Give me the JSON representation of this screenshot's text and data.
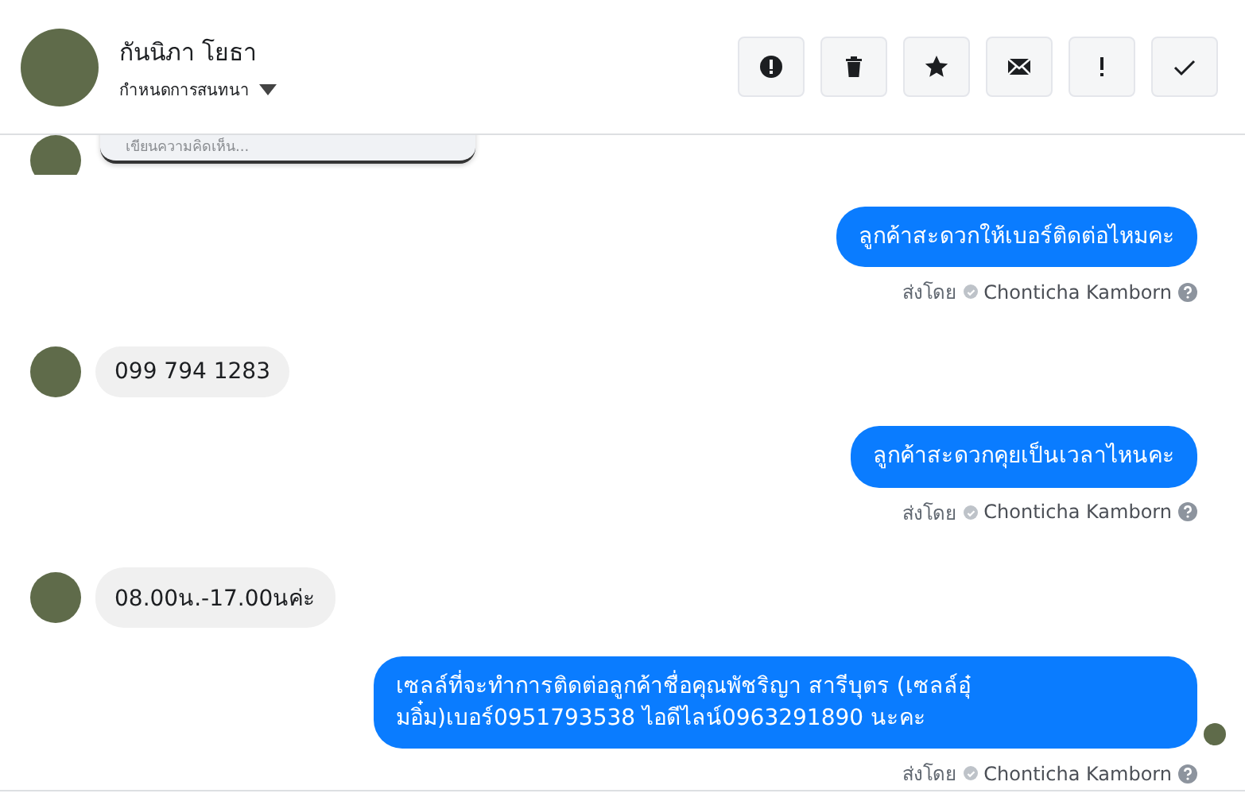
{
  "header": {
    "name": "กันนิภา โยธา",
    "subtitle": "กำหนดการสนทนา"
  },
  "actions": [
    {
      "kind": "alert"
    },
    {
      "kind": "trash"
    },
    {
      "kind": "star"
    },
    {
      "kind": "mail"
    },
    {
      "kind": "important"
    },
    {
      "kind": "done"
    }
  ],
  "comment_box": {
    "placeholder": "เขียนความคิดเห็น..."
  },
  "messages": [
    {
      "kind": "outgoing",
      "text": "ลูกค้าสะดวกให้เบอร์ติดต่อไหมคะ",
      "sent_by_label": "ส่งโดย",
      "sender": "Chonticha Kamborn",
      "seen": false
    },
    {
      "kind": "incoming",
      "text": "099 794 1283"
    },
    {
      "kind": "outgoing",
      "text": "ลูกค้าสะดวกคุยเป็นเวลาไหนคะ",
      "sent_by_label": "ส่งโดย",
      "sender": "Chonticha Kamborn",
      "seen": false
    },
    {
      "kind": "incoming",
      "text": "08.00น.-17.00นค่ะ"
    },
    {
      "kind": "outgoing",
      "text": "เซลล์ที่จะทำการติดต่อลูกค้าชื่อคุณพัชริญา สารีบุตร (เซลล์อุ๋มอิ๋ม)เบอร์0951793538 ไอดีไลน์0963291890 นะคะ",
      "sent_by_label": "ส่งโดย",
      "sender": "Chonticha Kamborn",
      "seen": true
    }
  ]
}
